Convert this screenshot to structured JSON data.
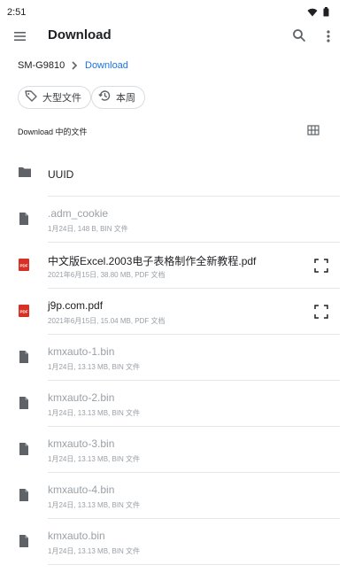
{
  "status_bar": {
    "time": "2:51"
  },
  "app_bar": {
    "title": "Download"
  },
  "breadcrumb": {
    "root": "SM-G9810",
    "current": "Download"
  },
  "chips": [
    {
      "label": "大型文件"
    },
    {
      "label": "本周"
    }
  ],
  "section": {
    "title": "Download 中的文件"
  },
  "files": [
    {
      "name": "UUID",
      "meta": "",
      "type": "folder",
      "dimmed": false
    },
    {
      "name": ".adm_cookie",
      "meta": "1月24日, 148 B, BIN 文件",
      "type": "file",
      "dimmed": true
    },
    {
      "name": "中文版Excel.2003电子表格制作全新教程.pdf",
      "meta": "2021年6月15日, 38.80 MB, PDF 文档",
      "type": "pdf",
      "dimmed": false
    },
    {
      "name": "j9p.com.pdf",
      "meta": "2021年6月15日, 15.04 MB, PDF 文档",
      "type": "pdf",
      "dimmed": false
    },
    {
      "name": "kmxauto-1.bin",
      "meta": "1月24日, 13.13 MB, BIN 文件",
      "type": "file",
      "dimmed": true
    },
    {
      "name": "kmxauto-2.bin",
      "meta": "1月24日, 13.13 MB, BIN 文件",
      "type": "file",
      "dimmed": true
    },
    {
      "name": "kmxauto-3.bin",
      "meta": "1月24日, 13.13 MB, BIN 文件",
      "type": "file",
      "dimmed": true
    },
    {
      "name": "kmxauto-4.bin",
      "meta": "1月24日, 13.13 MB, BIN 文件",
      "type": "file",
      "dimmed": true
    },
    {
      "name": "kmxauto.bin",
      "meta": "1月24日, 13.13 MB, BIN 文件",
      "type": "file",
      "dimmed": true
    }
  ],
  "colors": {
    "accent": "#1a73e8",
    "pdf_red": "#d93025",
    "icon_gray": "#5f6368"
  }
}
